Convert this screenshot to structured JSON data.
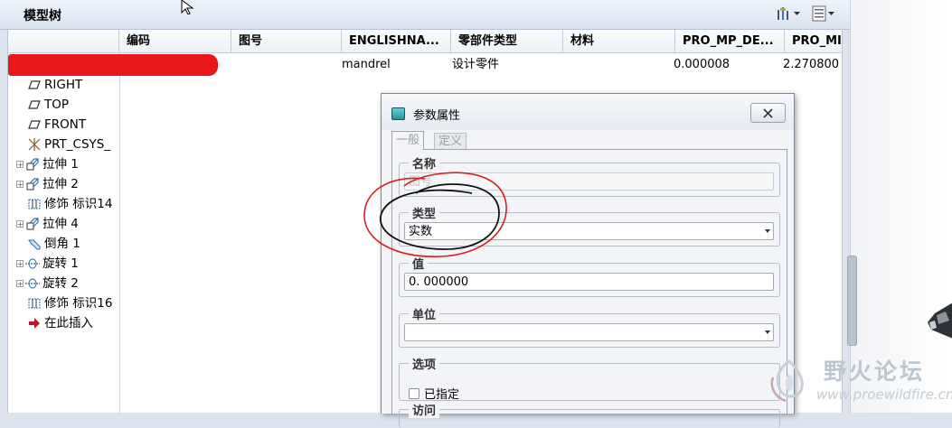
{
  "panel": {
    "title": "模型树"
  },
  "columns": [
    "编码",
    "图号",
    "ENGLISHNA...",
    "零部件类型",
    "材料",
    "PRO_MP_DE...",
    "PRO_MI"
  ],
  "root_row": {
    "englishname": "mandrel",
    "part_type": "设计零件",
    "pro_mp_de": "0.000008",
    "pro_mi": "2.270800"
  },
  "tree": [
    {
      "label": "RIGHT",
      "icon": "datum-plane-icon",
      "expandable": false
    },
    {
      "label": "TOP",
      "icon": "datum-plane-icon",
      "expandable": false
    },
    {
      "label": "FRONT",
      "icon": "datum-plane-icon",
      "expandable": false
    },
    {
      "label": "PRT_CSYS_",
      "icon": "coordinate-system-icon",
      "expandable": false
    },
    {
      "label": "拉伸 1",
      "icon": "extrude-icon",
      "expandable": true
    },
    {
      "label": "拉伸 2",
      "icon": "extrude-icon",
      "expandable": true
    },
    {
      "label": "修饰 标识14",
      "icon": "cosmetic-icon",
      "expandable": false
    },
    {
      "label": "拉伸 4",
      "icon": "extrude-icon",
      "expandable": true
    },
    {
      "label": "倒角 1",
      "icon": "chamfer-icon",
      "expandable": false
    },
    {
      "label": "旋转 1",
      "icon": "revolve-icon",
      "expandable": true
    },
    {
      "label": "旋转 2",
      "icon": "revolve-icon",
      "expandable": true
    },
    {
      "label": "修饰 标识16",
      "icon": "cosmetic-icon",
      "expandable": false
    },
    {
      "label": "在此插入",
      "icon": "insert-arrow-icon",
      "expandable": false
    }
  ],
  "dialog": {
    "title": "参数属性",
    "tabs": [
      "一般",
      "定义"
    ],
    "name_group": {
      "label": "名称",
      "placeholder": "图号"
    },
    "type_group": {
      "label": "类型",
      "value": "实数"
    },
    "value_group": {
      "label": "值",
      "value": "0. 000000"
    },
    "unit_group": {
      "label": "单位",
      "value": ""
    },
    "options_group": {
      "label": "选项",
      "checkbox_label": "已指定"
    },
    "access_group": {
      "label": "访问"
    }
  },
  "watermark": {
    "text": "野火论坛",
    "url": "www.proewildfire.cn"
  },
  "colors": {
    "redaction": "#e8171b",
    "annotation_red": "#d62020",
    "annotation_black": "#111111",
    "insert_arrow": "#c8102e"
  }
}
